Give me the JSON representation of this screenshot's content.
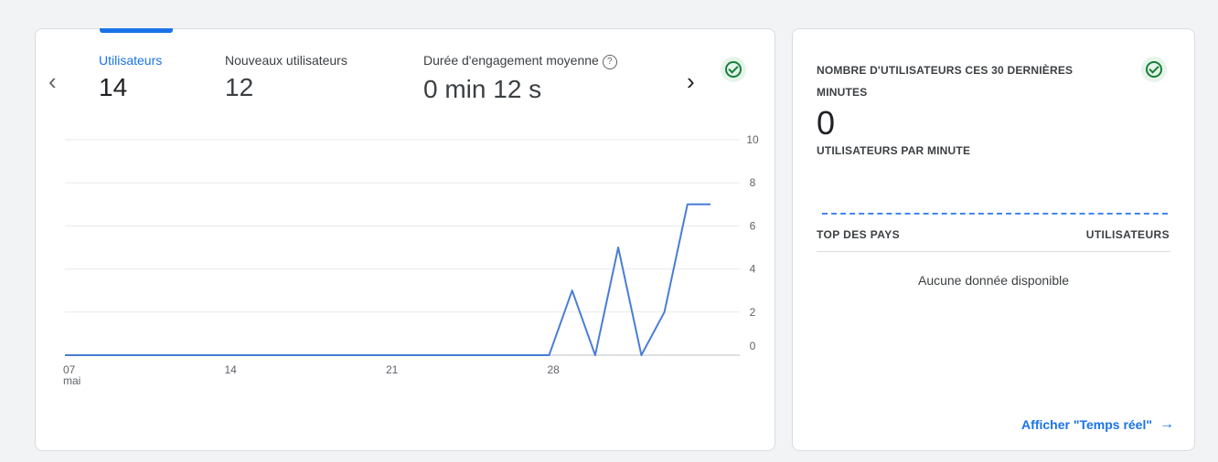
{
  "overview": {
    "metrics": [
      {
        "label": "Utilisateurs",
        "value": "14"
      },
      {
        "label": "Nouveaux utilisateurs",
        "value": "12"
      },
      {
        "label": "Durée d'engagement moyenne",
        "value": "0 min 12 s"
      }
    ],
    "prev_icon": "chevron-left-icon",
    "next_icon": "chevron-right-icon",
    "help_icon": "question-circle-icon",
    "status_icon": "check-circle-icon"
  },
  "chart_data": {
    "type": "line",
    "x_tick_labels": [
      {
        "day": 7,
        "label": "07",
        "sub": "mai"
      },
      {
        "day": 14,
        "label": "14",
        "sub": ""
      },
      {
        "day": 21,
        "label": "21",
        "sub": ""
      },
      {
        "day": 28,
        "label": "28",
        "sub": ""
      }
    ],
    "x_range": [
      7,
      35
    ],
    "ylim": [
      0,
      10
    ],
    "y_ticks": [
      0,
      2,
      4,
      6,
      8,
      10
    ],
    "grid": true,
    "series": [
      {
        "color": "#4a7dd6",
        "x": [
          7,
          8,
          9,
          10,
          11,
          12,
          13,
          14,
          15,
          16,
          17,
          18,
          19,
          20,
          21,
          22,
          23,
          24,
          25,
          26,
          27,
          28,
          29,
          30,
          31,
          32,
          33,
          34,
          35
        ],
        "values": [
          0,
          0,
          0,
          0,
          0,
          0,
          0,
          0,
          0,
          0,
          0,
          0,
          0,
          0,
          0,
          0,
          0,
          0,
          0,
          0,
          0,
          0,
          3,
          0,
          5,
          0,
          2,
          7,
          7
        ]
      }
    ]
  },
  "realtime": {
    "title": "NOMBRE D'UTILISATEURS CES 30 DERNIÈRES MINUTES",
    "count": "0",
    "subtitle": "UTILISATEURS PAR MINUTE",
    "col_country": "TOP DES PAYS",
    "col_users": "UTILISATEURS",
    "empty_message": "Aucune donnée disponible",
    "link_label": "Afficher \"Temps réel\"",
    "link_icon": "arrow-right-icon",
    "status_icon": "check-circle-icon"
  },
  "colors": {
    "accent": "#1a73e8",
    "success": "#188038",
    "line": "#4a7dd6"
  }
}
